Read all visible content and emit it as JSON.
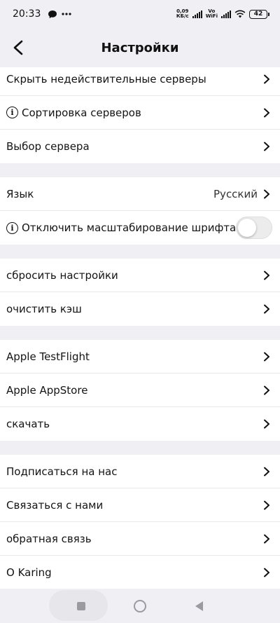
{
  "status_bar": {
    "time": "20:33",
    "net_speed_top": "0,09",
    "net_speed_bottom": "КБ/с",
    "vowifi_top": "Vo",
    "vowifi_bottom": "WiFi",
    "battery": "42"
  },
  "header": {
    "title": "Настройки"
  },
  "groups": [
    {
      "rows": [
        {
          "label": "Скрыть недействительные серверы"
        },
        {
          "label": "Сортировка серверов",
          "info": true
        },
        {
          "label": "Выбор сервера"
        }
      ]
    },
    {
      "rows": [
        {
          "label": "Язык",
          "value": "Русский"
        },
        {
          "label": "Отключить масштабирование шрифта",
          "info": true,
          "toggle": false
        }
      ]
    },
    {
      "rows": [
        {
          "label": "сбросить настройки"
        },
        {
          "label": "очистить кэш"
        }
      ]
    },
    {
      "rows": [
        {
          "label": "Apple TestFlight"
        },
        {
          "label": "Apple AppStore"
        },
        {
          "label": "скачать"
        }
      ]
    },
    {
      "rows": [
        {
          "label": "Подписаться на нас"
        },
        {
          "label": "Связаться с нами"
        },
        {
          "label": "обратная связь"
        },
        {
          "label": "О Karing"
        }
      ]
    }
  ],
  "icons": {
    "back": "chevron-left-icon",
    "row_arrow": "chevron-right-icon",
    "info": "info-icon"
  }
}
